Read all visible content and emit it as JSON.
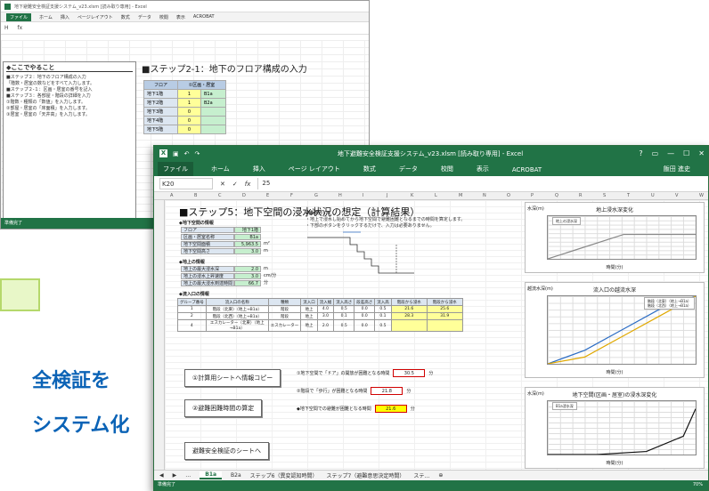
{
  "back_window": {
    "title": "地下避難安全検証支援システム_v23.xlsm [読み取り専用] - Excel",
    "ribbon_tabs": [
      "ファイル",
      "ホーム",
      "挿入",
      "ページレイアウト",
      "数式",
      "データ",
      "校閲",
      "表示",
      "ACROBAT"
    ],
    "name_box": "H",
    "step_title": "■ステップ2-1：地下のフロア構成の入力",
    "left_pane_header": "◆ここでやること",
    "left_pane_lines": [
      "■ステップ２：地下のフロア構成の入力",
      "「階数・居室の数などをすべて入力します。",
      "■ステップ２-１：区画・居室の番号を記入",
      "■ステップ３：各部屋・階段の詳細を入力",
      "①階数・種類の「数値」を入力します。",
      "②部屋・居室の「床面積」を入力します。",
      "③居室・居室の「天井高」を入力します。"
    ],
    "floor_table": {
      "header": [
        "フロア",
        "①区画・居室"
      ],
      "rows": [
        {
          "label": "地下1階",
          "value": "1",
          "code": "B1a"
        },
        {
          "label": "地下2階",
          "value": "1",
          "code": "B2a"
        },
        {
          "label": "地下3階",
          "value": "0",
          "code": ""
        },
        {
          "label": "地下4階",
          "value": "0",
          "code": ""
        },
        {
          "label": "地下5階",
          "value": "0",
          "code": ""
        }
      ]
    },
    "status": "準備完了"
  },
  "callouts": {
    "line1": "全検証を",
    "line2": "システム化"
  },
  "front_window": {
    "title": "地下避難安全検証支援システム_v23.xlsm [読み取り専用] - Excel",
    "user": "飯田 進史",
    "ribbon_tabs": [
      "ファイル",
      "ホーム",
      "挿入",
      "ページ レイアウト",
      "数式",
      "データ",
      "校閲",
      "表示",
      "ACROBAT"
    ],
    "name_box": "K20",
    "formula_value": "25",
    "column_letters": [
      "A",
      "B",
      "C",
      "D",
      "E",
      "F",
      "G",
      "H",
      "I",
      "J",
      "K",
      "L",
      "M",
      "N",
      "O",
      "P",
      "Q",
      "R",
      "S",
      "T",
      "U",
      "V",
      "W"
    ],
    "step_title": "■ステップ5：地下空間の浸水状況の想定（計算結果）",
    "floor_section": "◆地下空間の情報",
    "floor_info": [
      {
        "k": "フロア",
        "v": "地下1階",
        "u": ""
      },
      {
        "k": "区画・居室名称",
        "v": "B1a",
        "u": ""
      },
      {
        "k": "地下空間面積",
        "v": "5,963.5",
        "u": "m²"
      },
      {
        "k": "地下空間高さ",
        "v": "3.0",
        "u": "m"
      }
    ],
    "ground_section": "◆地上の情報",
    "ground_info": [
      {
        "k": "地上の最大浸水深",
        "v": "2.0",
        "u": "m"
      },
      {
        "k": "地上の浸水上昇速度",
        "v": "3.0",
        "u": "cm/分"
      },
      {
        "k": "地上の最大浸水到達時間",
        "v": "66.7",
        "u": "分"
      }
    ],
    "entry_section": "◆流入口の情報",
    "guide_title": "◆操作ガイド",
    "guide_lines": [
      "・地上で浸水し始めてから地下空間で避難困難となるまでの時間を算定します。",
      "・下部のボタンをクリックするだけで、入力は必要ありません。"
    ],
    "entry_headers": [
      "グループ番号",
      "流入口の名称",
      "種類",
      "流入口",
      "流入幅",
      "流入高さ",
      "段差高さ",
      "流入高",
      "階段から浸水",
      "階段から浸水"
    ],
    "entry_rows": [
      [
        "1",
        "階段（北東）（地上→B1a）",
        "階段",
        "地上",
        "4.0",
        "0.5",
        "0.0",
        "0.5",
        "21.6",
        "25.6"
      ],
      [
        "2",
        "階段（北西）（地上→B1a）",
        "階段",
        "地上",
        "3.0",
        "0.1",
        "0.0",
        "0.1",
        "28.3",
        "31.9"
      ],
      [
        "4",
        "エスカレーター（北東）（地上→B1a）",
        "エスカレーター",
        "地上",
        "2.0",
        "0.5",
        "0.0",
        "0.5",
        "",
        ""
      ]
    ],
    "buttons": {
      "calc_copy": "①計算用シートへ情報コピー",
      "evac_time": "②避難困難時間の算定",
      "to_sheet": "避難安全検証のシートへ"
    },
    "results": [
      {
        "label": "①地下空間で「ドア」の開放が困難となる時間",
        "value": "30.5",
        "unit": "分"
      },
      {
        "label": "②階段で「歩行」が困難となる時間",
        "value": "21.8",
        "unit": "分"
      },
      {
        "label": "◆地下空間での避難が困難となる時間",
        "value": "21.6",
        "unit": "分"
      }
    ],
    "sheet_tabs": [
      "B1a",
      "B2a",
      "ステップ6（異変認知時間）",
      "ステップ7（避難意思決定時間）",
      "ステ…"
    ],
    "active_tab": "B1a",
    "status": "準備完了",
    "zoom": "70%"
  },
  "chart_data": [
    {
      "type": "line",
      "title": "地上浸水深変化",
      "ylabel": "水深(m)",
      "xlabel": "時間(分)",
      "ylim": [
        0,
        3.5
      ],
      "x": [
        0,
        66.7,
        130
      ],
      "series": [
        {
          "name": "地上の浸水深",
          "values": [
            0,
            2.0,
            2.0
          ]
        }
      ]
    },
    {
      "type": "line",
      "title": "流入口の越流水深",
      "ylabel": "越流水深(m)",
      "xlabel": "時間(分)",
      "ylim": [
        0,
        1.0
      ],
      "x": [
        10,
        20,
        30,
        40,
        50
      ],
      "series": [
        {
          "name": "階段（北東）（地上→B1a）",
          "values": [
            0.0,
            0.2,
            0.5,
            0.8,
            1.0
          ]
        },
        {
          "name": "階段（北西）（地上→B1a）",
          "values": [
            0.0,
            0.1,
            0.4,
            0.7,
            1.0
          ]
        }
      ]
    },
    {
      "type": "line",
      "title": "地下空間(区画・居室)の浸水深変化",
      "ylabel": "水深(m)",
      "xlabel": "時間(分)",
      "ylim": [
        0,
        3.5
      ],
      "x": [
        0,
        20,
        40,
        55,
        60
      ],
      "series": [
        {
          "name": "B1a浸水深",
          "values": [
            0,
            0,
            0.2,
            1.2,
            3.0
          ]
        }
      ]
    }
  ]
}
